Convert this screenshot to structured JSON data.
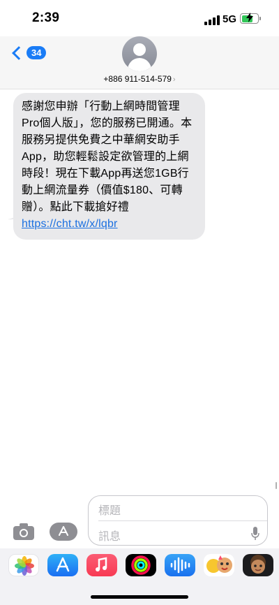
{
  "status_bar": {
    "time": "2:39",
    "network": "5G",
    "battery_charging": true,
    "accent": "#32c759"
  },
  "header": {
    "back_badge": "34",
    "contact": "+886 911-514-579",
    "chevron": "›",
    "accent": "#1a7cf6"
  },
  "message": {
    "text": "感謝您申辦「行動上網時間管理Pro個人版」，您的服務已開通。本服務另提供免費之中華網安助手App，助您輕鬆設定欲管理的上網時段！現在下載App再送您1GB行動上網流量券（價值$180、可轉贈）。點此下載搶好禮 ",
    "link": "https://cht.tw/x/lqbr",
    "bubble_color": "#e9e9eb"
  },
  "compose": {
    "subject_placeholder": "標題",
    "message_placeholder": "訊息"
  },
  "app_drawer": {
    "apps": [
      "photos-app-icon",
      "app-store-icon",
      "music-app-icon",
      "fitness-app-icon",
      "audio-message-icon",
      "memoji-stickers-icon",
      "memoji-avatar-icon"
    ]
  }
}
